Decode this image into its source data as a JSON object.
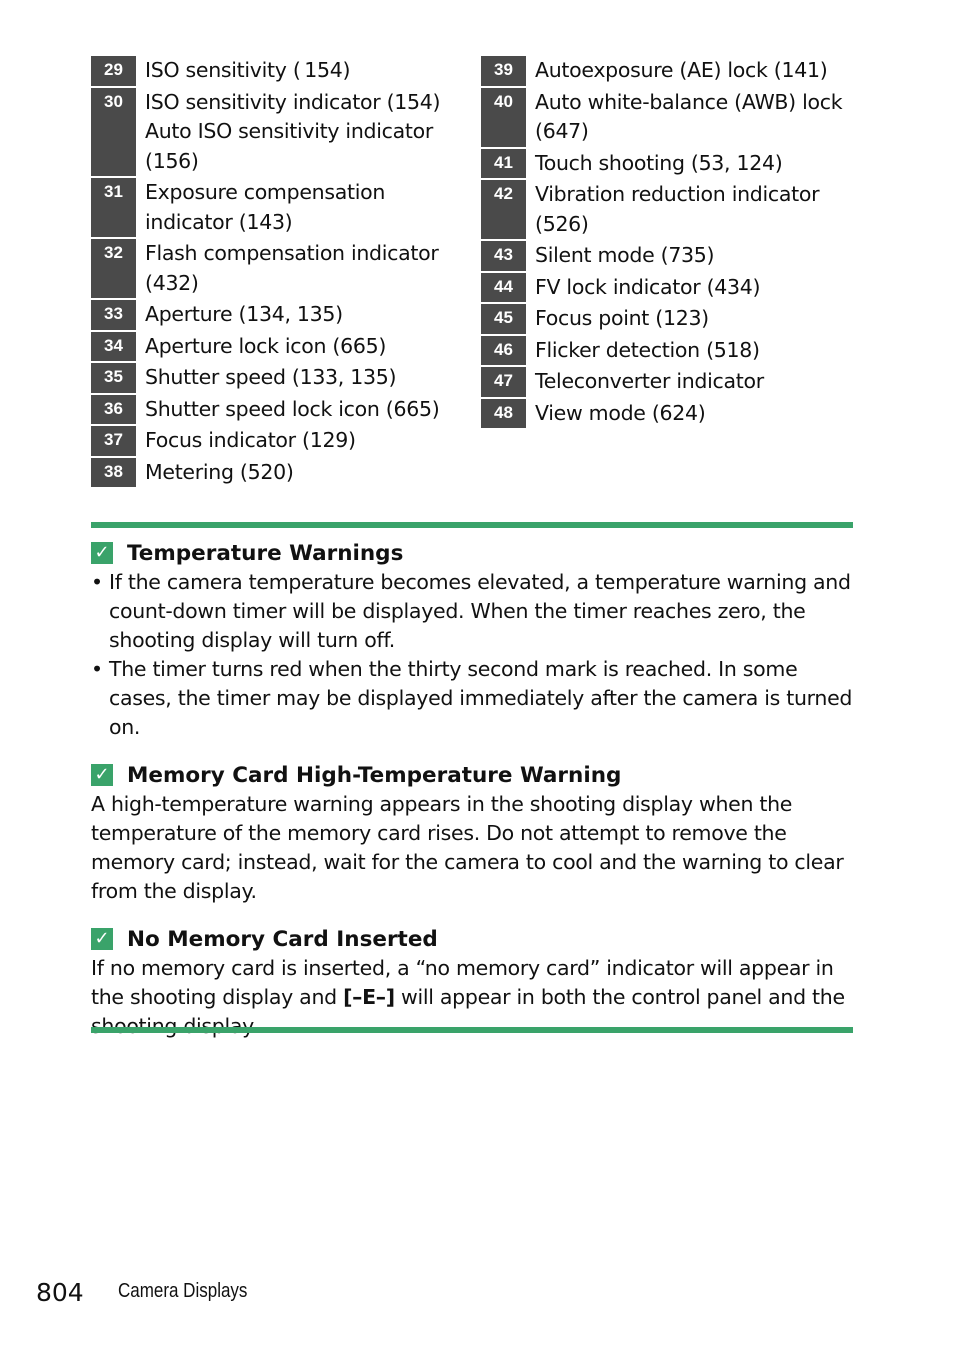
{
  "left_items": [
    {
      "num": "29",
      "text": "ISO sensitivity ( 154)"
    },
    {
      "num": "30",
      "text": "ISO sensitivity indicator (154)\nAuto ISO sensitivity indicator\n(156)"
    },
    {
      "num": "31",
      "text": "Exposure compensation\nindicator (143)"
    },
    {
      "num": "32",
      "text": "Flash compensation indicator\n(432)"
    },
    {
      "num": "33",
      "text": "Aperture (134, 135)"
    },
    {
      "num": "34",
      "text": "Aperture lock icon (665)"
    },
    {
      "num": "35",
      "text": "Shutter speed (133, 135)"
    },
    {
      "num": "36",
      "text": "Shutter speed lock icon (665)"
    },
    {
      "num": "37",
      "text": "Focus indicator (129)"
    },
    {
      "num": "38",
      "text": "Metering (520)"
    }
  ],
  "right_items": [
    {
      "num": "39",
      "text": "Autoexposure (AE) lock (141)"
    },
    {
      "num": "40",
      "text": "Auto white-balance (AWB) lock\n(647)"
    },
    {
      "num": "41",
      "text": "Touch shooting (53, 124)"
    },
    {
      "num": "42",
      "text": "Vibration reduction indicator\n(526)"
    },
    {
      "num": "43",
      "text": "Silent mode (735)"
    },
    {
      "num": "44",
      "text": "FV lock indicator (434)"
    },
    {
      "num": "45",
      "text": "Focus point (123)"
    },
    {
      "num": "46",
      "text": "Flicker detection (518)"
    },
    {
      "num": "47",
      "text": "Teleconverter indicator"
    },
    {
      "num": "48",
      "text": "View mode (624)"
    }
  ],
  "sections": {
    "temp": {
      "title": "Temperature Warnings",
      "bullets": [
        "If the camera temperature becomes elevated, a temperature warning and count-down timer will be displayed. When the timer reaches zero, the shooting display will turn off.",
        "The timer turns red when the thirty second mark is reached. In some cases, the timer may be displayed immediately after the camera is turned on."
      ]
    },
    "memtemp": {
      "title": "Memory Card High-Temperature Warning",
      "body": "A high-temperature warning appears in the shooting display when the temperature of the memory card rises. Do not attempt to remove the memory card; instead, wait for the camera to cool and the warning to clear from the display."
    },
    "nocard": {
      "title": "No Memory Card Inserted",
      "body_pre": "If no memory card is inserted, a “no memory card” indicator will appear in the shooting display and ",
      "body_bold": "[–E–]",
      "body_post": " will appear in both the control panel and the shooting display."
    }
  },
  "footer": {
    "page_number": "804",
    "section_title": "Camera Displays"
  },
  "colors": {
    "accent": "#3aa36a",
    "number_box": "#4a4a4a"
  }
}
